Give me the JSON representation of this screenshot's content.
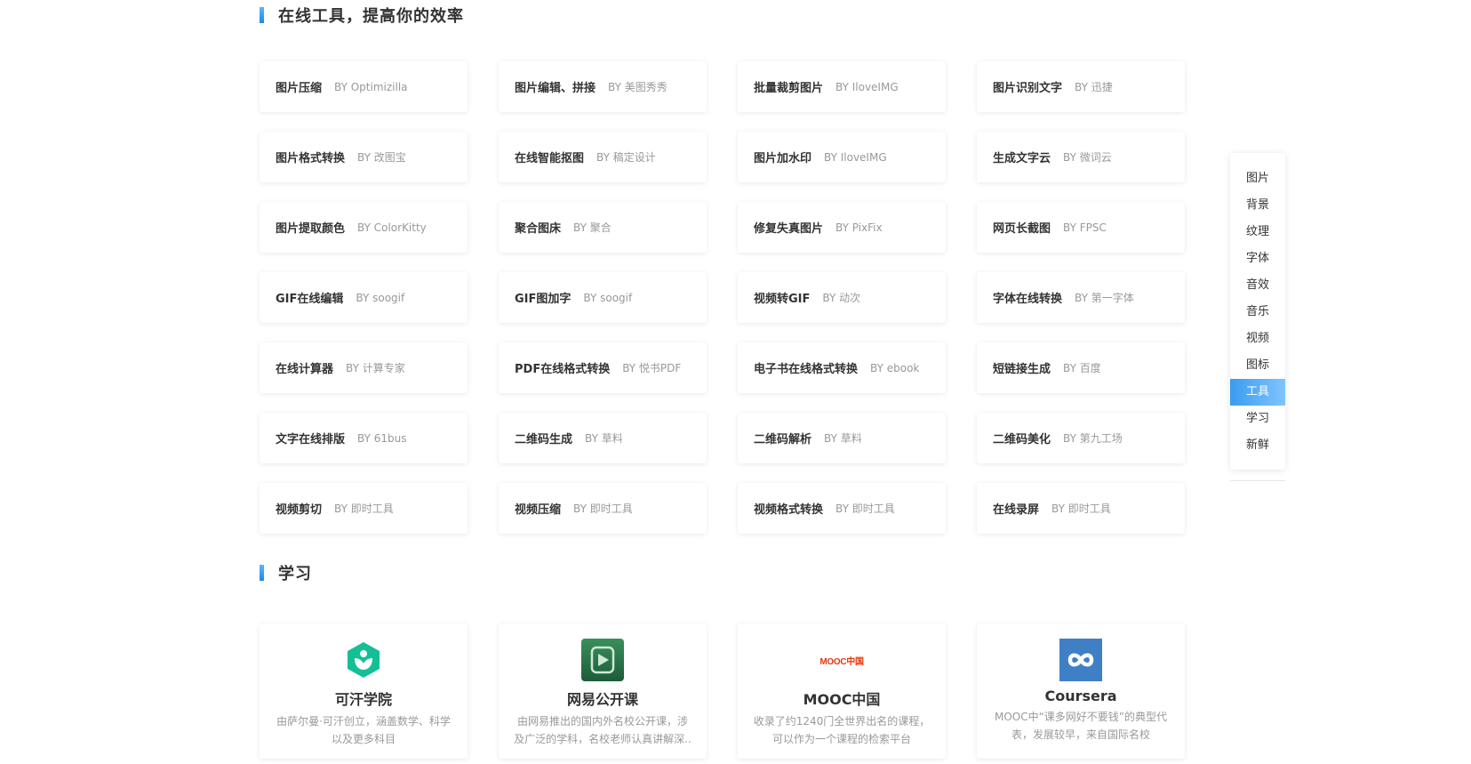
{
  "sections": {
    "tools_title": "在线工具，提高你的效率",
    "learn_title": "学习"
  },
  "tools": [
    {
      "name": "图片压缩",
      "by": "BY Optimizilla"
    },
    {
      "name": "图片编辑、拼接",
      "by": "BY 美图秀秀"
    },
    {
      "name": "批量裁剪图片",
      "by": "BY IloveIMG"
    },
    {
      "name": "图片识别文字",
      "by": "BY 迅捷"
    },
    {
      "name": "图片格式转换",
      "by": "BY 改图宝"
    },
    {
      "name": "在线智能抠图",
      "by": "BY 稿定设计"
    },
    {
      "name": "图片加水印",
      "by": "BY IloveIMG"
    },
    {
      "name": "生成文字云",
      "by": "BY 微词云"
    },
    {
      "name": "图片提取颜色",
      "by": "BY ColorKitty"
    },
    {
      "name": "聚合图床",
      "by": "BY 聚合"
    },
    {
      "name": "修复失真图片",
      "by": "BY PixFix"
    },
    {
      "name": "网页长截图",
      "by": "BY FPSC"
    },
    {
      "name": "GIF在线编辑",
      "by": "BY soogif"
    },
    {
      "name": "GIF图加字",
      "by": "BY soogif"
    },
    {
      "name": "视频转GIF",
      "by": "BY 动次"
    },
    {
      "name": "字体在线转换",
      "by": "BY 第一字体"
    },
    {
      "name": "在线计算器",
      "by": "BY 计算专家"
    },
    {
      "name": "PDF在线格式转换",
      "by": "BY 悦书PDF"
    },
    {
      "name": "电子书在线格式转换",
      "by": "BY ebook"
    },
    {
      "name": "短链接生成",
      "by": "BY 百度"
    },
    {
      "name": "文字在线排版",
      "by": "BY 61bus"
    },
    {
      "name": "二维码生成",
      "by": "BY 草料"
    },
    {
      "name": "二维码解析",
      "by": "BY 草料"
    },
    {
      "name": "二维码美化",
      "by": "BY 第九工场"
    },
    {
      "name": "视频剪切",
      "by": "BY 即时工具"
    },
    {
      "name": "视频压缩",
      "by": "BY 即时工具"
    },
    {
      "name": "视频格式转换",
      "by": "BY 即时工具"
    },
    {
      "name": "在线录屏",
      "by": "BY 即时工具"
    }
  ],
  "learn": [
    {
      "name": "可汗学院",
      "desc": "由萨尔曼·可汗创立，涵盖数学、科学以及更多科目",
      "icon": "khan-academy-logo",
      "color": "#14bf96"
    },
    {
      "name": "网易公开课",
      "desc": "由网易推出的国内外名校公开课，涉及广泛的学科，名校老师认真讲解深..",
      "icon": "netease-open-course-logo",
      "color": "#2e7d4f"
    },
    {
      "name": "MOOC中国",
      "desc": "收录了约1240门全世界出名的课程，可以作为一个课程的检索平台",
      "icon": "mooc-china-logo",
      "logo_text": "MOOC中国",
      "color": "#e8380d"
    },
    {
      "name": "Coursera",
      "desc": "MOOC中“课多网好不要钱”的典型代表，发展较早，来自国际名校",
      "icon": "coursera-logo",
      "color": "#3f7fc6"
    }
  ],
  "side_nav": {
    "items": [
      "图片",
      "背景",
      "纹理",
      "字体",
      "音效",
      "音乐",
      "视频",
      "图标",
      "工具",
      "学习",
      "新鲜"
    ],
    "active": "工具"
  }
}
